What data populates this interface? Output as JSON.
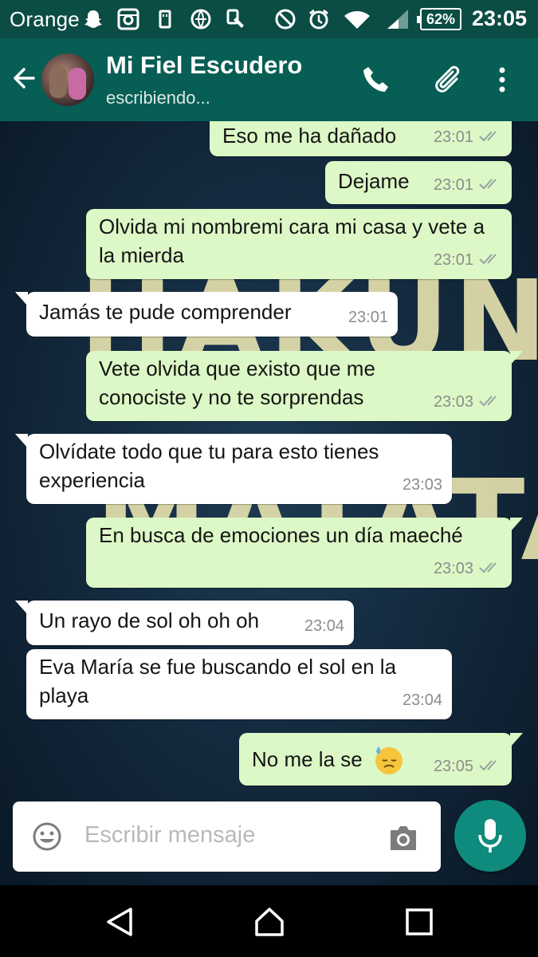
{
  "status_bar": {
    "carrier": "Orange",
    "battery": "62%",
    "time": "23:05",
    "icons": [
      "snapchat-icon",
      "instagram-icon",
      "usb-icon",
      "nfc-icon",
      "hand-pointer-icon",
      "do-not-disturb-icon",
      "alarm-icon",
      "wifi-icon",
      "signal-icon"
    ]
  },
  "header": {
    "contact_name": "Mi Fiel Escudero",
    "status": "escribiendo...",
    "icons": [
      "back-arrow-icon",
      "phone-icon",
      "attach-icon",
      "more-icon"
    ]
  },
  "messages": [
    {
      "side": "out",
      "text": "Eso me ha dañado",
      "time": "23:01",
      "ticks": true
    },
    {
      "side": "out",
      "text": "Dejame",
      "time": "23:01",
      "ticks": true
    },
    {
      "side": "out",
      "text": "Olvida mi nombremi cara mi casa  y vete a la mierda",
      "time": "23:01",
      "ticks": true
    },
    {
      "side": "in",
      "text": "Jamás te pude comprender",
      "time": "23:01"
    },
    {
      "side": "out",
      "text": "Vete olvida que existo que me conociste y no te sorprendas",
      "time": "23:03",
      "ticks": true
    },
    {
      "side": "in",
      "text": "Olvídate todo que tu para esto tienes experiencia",
      "time": "23:03"
    },
    {
      "side": "out",
      "text": "En busca de emociones un día maeché",
      "time": "23:03",
      "ticks": true
    },
    {
      "side": "in",
      "text": "Un rayo de sol oh oh oh",
      "time": "23:04"
    },
    {
      "side": "in",
      "text": "Eva María se fue buscando el sol en la playa",
      "time": "23:04"
    },
    {
      "side": "out",
      "text": "No me la se",
      "emoji": "downcast-sweat-face-emoji",
      "time": "23:05",
      "ticks": true
    }
  ],
  "wallpaper_text": [
    "HAKUNA",
    "MATATA"
  ],
  "composer": {
    "placeholder": "Escribir mensaje",
    "icons": [
      "emoji-icon",
      "camera-icon",
      "mic-icon"
    ]
  },
  "colors": {
    "header": "#075e54",
    "status_bar": "#0b4c44",
    "outgoing_bubble": "#dcf8c6",
    "incoming_bubble": "#ffffff",
    "mic_button": "#0e8b7c"
  },
  "nav_icons": [
    "nav-back-icon",
    "nav-home-icon",
    "nav-recents-icon"
  ]
}
